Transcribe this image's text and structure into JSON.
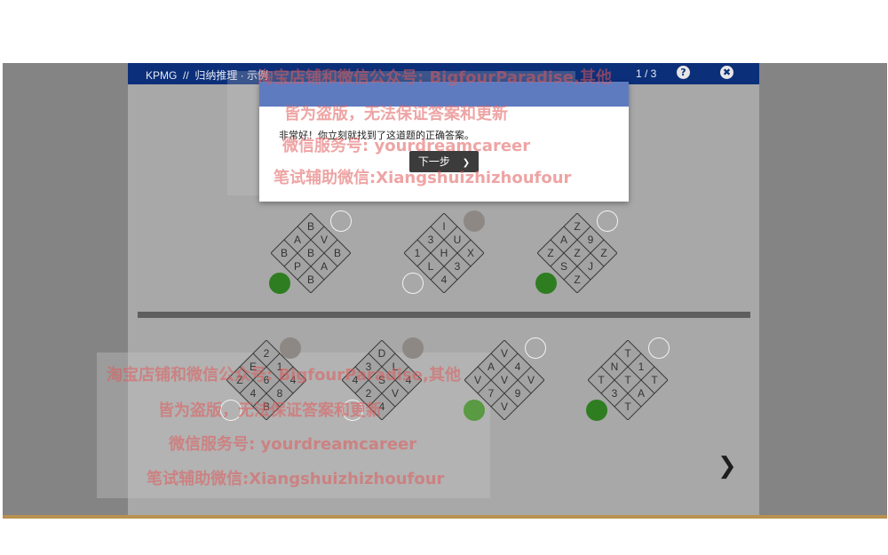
{
  "header": {
    "title": "KPMG  //  归纳推理 · 示例",
    "page_indicator": "1 / 3",
    "help_icon": "question-circle-icon",
    "close_icon": "close-circle-icon",
    "help_glyph": "?",
    "close_glyph": "✖"
  },
  "modal": {
    "message": "非常好！你立刻就找到了这道题的正确答案。",
    "next_label": "下一步",
    "next_glyph": "❯"
  },
  "navigation": {
    "next_arrow_glyph": "❯"
  },
  "colors": {
    "header_bg": "#0c2f7a",
    "modal_header": "#5f7bc0",
    "green_selected": "#2f7d21",
    "grey_circle": "#8e8884"
  },
  "puzzles_top": [
    {
      "cells": [
        "B",
        "A",
        "V",
        "B",
        "B",
        "B",
        "P",
        "A",
        "B"
      ]
    },
    {
      "cells": [
        "I",
        "3",
        "U",
        "1",
        "H",
        "X",
        "L",
        "3",
        "4"
      ]
    },
    {
      "cells": [
        "Z",
        "A",
        "9",
        "Z",
        "Z",
        "Z",
        "S",
        "J",
        "Z"
      ]
    }
  ],
  "puzzles_bottom": [
    {
      "cells": [
        "2",
        "E",
        "1",
        "Z",
        "6",
        "4",
        "4",
        "8",
        "B"
      ]
    },
    {
      "cells": [
        "D",
        "3",
        "L",
        "4",
        "S",
        "4",
        "2",
        "V",
        "4"
      ]
    },
    {
      "cells": [
        "V",
        "A",
        "4",
        "V",
        "V",
        "V",
        "7",
        "9",
        "V"
      ]
    },
    {
      "cells": [
        "T",
        "N",
        "1",
        "T",
        "T",
        "T",
        "3",
        "A",
        "T"
      ]
    }
  ],
  "watermarks": [
    "淘宝店铺和微信公众号: BigfourParadise,其他",
    "皆为盗版，无法保证答案和更新",
    "微信服务号: yourdreamcareer",
    "笔试辅助微信:Xiangshuizhizhoufour"
  ]
}
